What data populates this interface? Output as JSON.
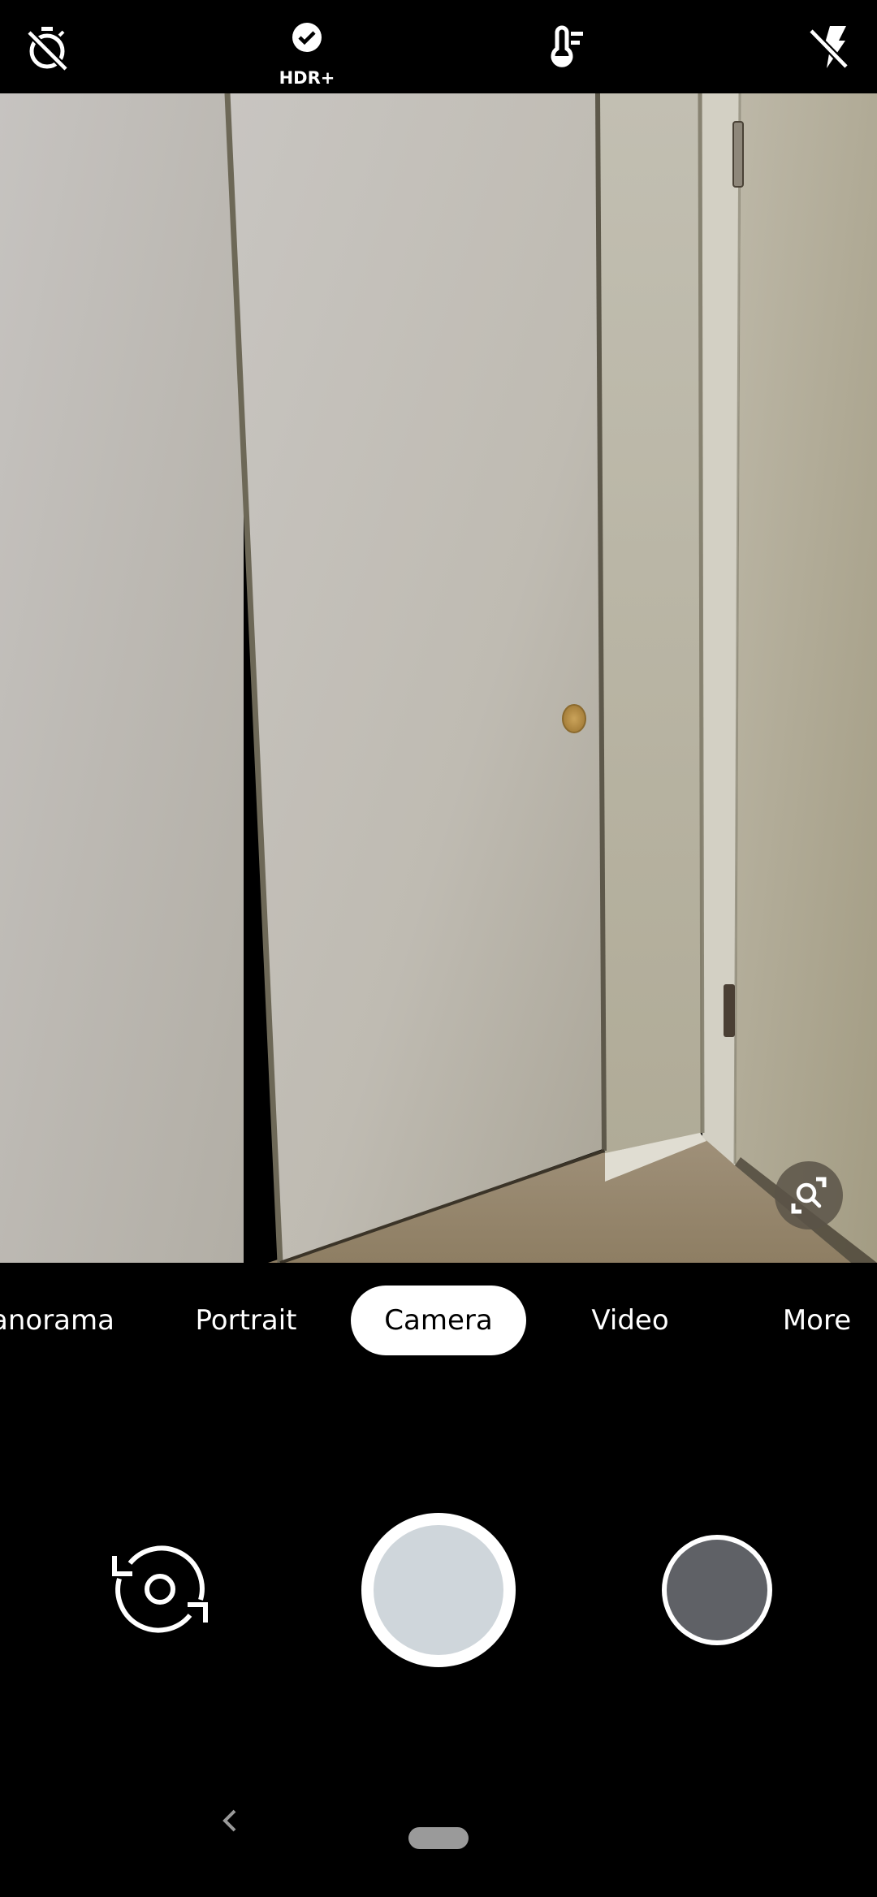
{
  "top_bar": {
    "timer": {
      "icon": "timer-off-icon",
      "state": "off"
    },
    "hdr": {
      "icon": "hdr-plus-check-icon",
      "label": "HDR+"
    },
    "white_balance": {
      "icon": "thermometer-wb-icon"
    },
    "flash": {
      "icon": "flash-off-icon",
      "state": "off"
    }
  },
  "viewfinder": {
    "scene": "closet door and wall corner",
    "lens_button": {
      "icon": "google-lens-icon"
    }
  },
  "modes": {
    "items": [
      {
        "label": "Panorama",
        "visible_text": "anorama",
        "active": false
      },
      {
        "label": "Portrait",
        "active": false
      },
      {
        "label": "Camera",
        "active": true
      },
      {
        "label": "Video",
        "active": false
      },
      {
        "label": "More",
        "active": false
      }
    ],
    "active_bg": "#ffffff"
  },
  "controls": {
    "switch_camera": {
      "icon": "switch-camera-icon"
    },
    "shutter": {
      "icon": "shutter-button",
      "inner_color": "#cfd6db"
    },
    "gallery_thumbnail": {
      "icon": "gallery-thumbnail",
      "color": "#5f6166"
    }
  },
  "navbar": {
    "back": {
      "icon": "back-chevron-icon"
    },
    "home": {
      "icon": "home-pill-icon"
    }
  }
}
